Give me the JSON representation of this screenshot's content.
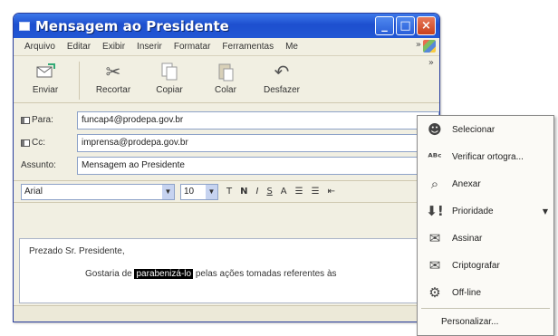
{
  "window": {
    "title": "Mensagem ao Presidente",
    "minimize_glyph": "_",
    "maximize_glyph": "□",
    "close_glyph": "×"
  },
  "menubar": {
    "items": [
      "Arquivo",
      "Editar",
      "Exibir",
      "Inserir",
      "Formatar",
      "Ferramentas",
      "Me"
    ],
    "overflow_glyph": "»"
  },
  "toolbar": {
    "buttons": [
      {
        "label": "Enviar",
        "icon": "send-icon"
      },
      {
        "label": "Recortar",
        "icon": "scissors-icon"
      },
      {
        "label": "Copiar",
        "icon": "copy-icon"
      },
      {
        "label": "Colar",
        "icon": "paste-icon"
      },
      {
        "label": "Desfazer",
        "icon": "undo-icon"
      }
    ],
    "overflow_glyph": "»"
  },
  "headers": {
    "to_label": "Para:",
    "to_value": "funcap4@prodepa.gov.br",
    "cc_label": "Cc:",
    "cc_value": "imprensa@prodepa.gov.br",
    "subject_label": "Assunto:",
    "subject_value": "Mensagem ao Presidente"
  },
  "format": {
    "font": "Arial",
    "size": "10",
    "bold": "N",
    "italic": "I",
    "underline": "S",
    "font_color": "A"
  },
  "body": {
    "greeting": "Prezado Sr. Presidente,",
    "line_before": "Gostaria de",
    "selected_word": "parabenizá-lo",
    "line_after": "pelas ações tomadas referentes às"
  },
  "popup_menu": {
    "items": [
      {
        "label": "Selecionar",
        "icon": "select-recipients-icon"
      },
      {
        "label": "Verificar ortogra...",
        "icon": "spellcheck-icon"
      },
      {
        "label": "Anexar",
        "icon": "paperclip-icon"
      },
      {
        "label": "Prioridade",
        "icon": "priority-icon",
        "has_submenu": true
      },
      {
        "label": "Assinar",
        "icon": "sign-icon"
      },
      {
        "label": "Criptografar",
        "icon": "encrypt-icon"
      },
      {
        "label": "Off-line",
        "icon": "offline-icon"
      }
    ],
    "customize_label": "Personalizar..."
  }
}
